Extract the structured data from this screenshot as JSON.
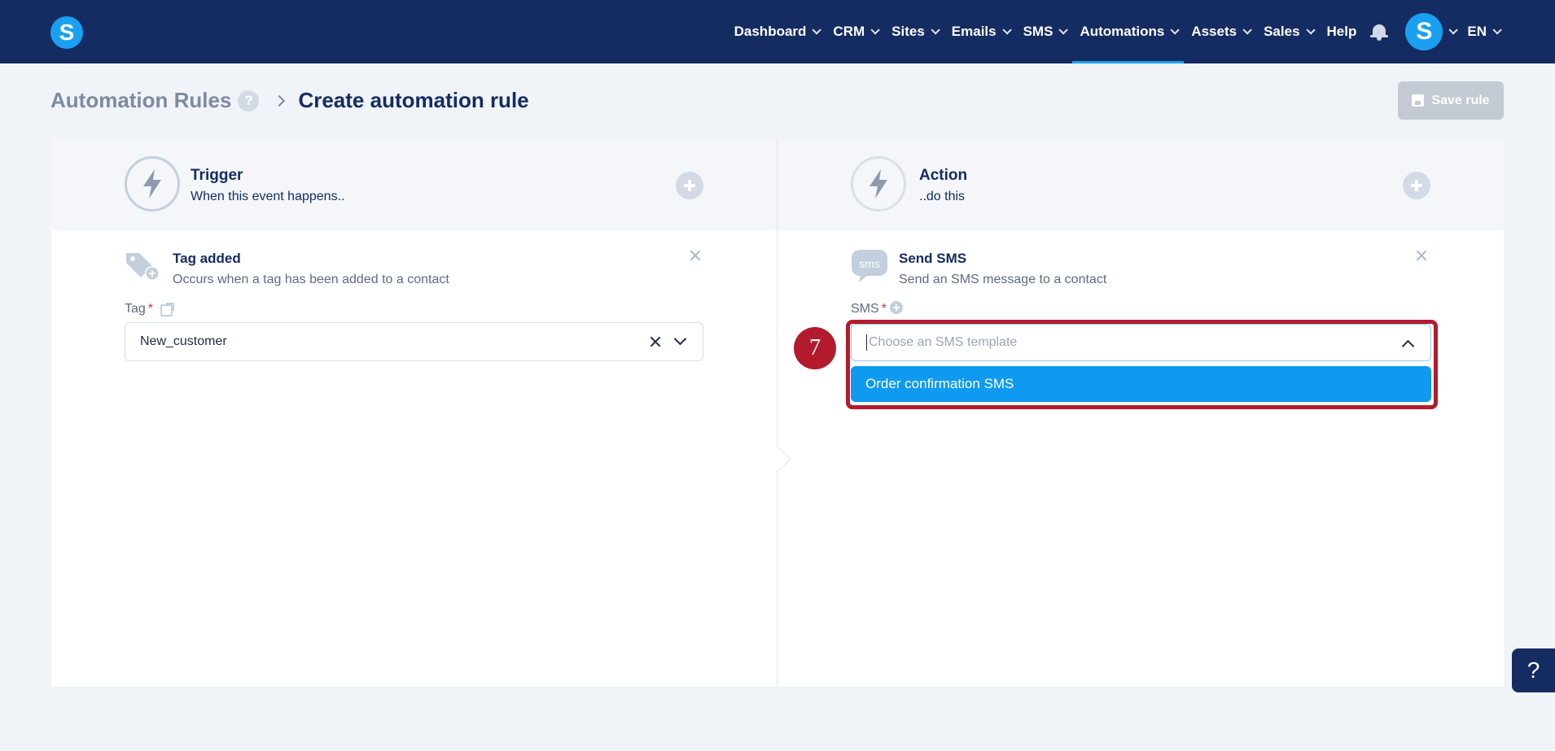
{
  "app": {
    "logo_letter": "S",
    "accent": "#1aa0f0",
    "nav_bg": "#152c62"
  },
  "nav": {
    "items": [
      {
        "label": "Dashboard",
        "dropdown": true
      },
      {
        "label": "CRM",
        "dropdown": true
      },
      {
        "label": "Sites",
        "dropdown": true
      },
      {
        "label": "Emails",
        "dropdown": true
      },
      {
        "label": "SMS",
        "dropdown": true
      },
      {
        "label": "Automations",
        "dropdown": true,
        "active": true
      },
      {
        "label": "Assets",
        "dropdown": true
      },
      {
        "label": "Sales",
        "dropdown": true
      },
      {
        "label": "Help",
        "dropdown": false
      }
    ],
    "avatar_letter": "S",
    "language": "EN"
  },
  "header": {
    "breadcrumb_parent": "Automation Rules",
    "help_mark": "?",
    "title": "Create automation rule",
    "save_label": "Save rule",
    "save_disabled": true
  },
  "trigger": {
    "title": "Trigger",
    "subtitle": "When this event happens..",
    "block": {
      "title": "Tag added",
      "description": "Occurs when a tag has been added to a contact",
      "field_label": "Tag",
      "required_mark": "*",
      "value": "New_customer"
    }
  },
  "action": {
    "title": "Action",
    "subtitle": "..do this",
    "block": {
      "icon_text": "sms",
      "title": "Send SMS",
      "description": "Send an SMS message to a contact",
      "field_label": "SMS",
      "required_mark": "*",
      "placeholder": "Choose an SMS template",
      "options": [
        "Order confirmation SMS"
      ]
    }
  },
  "annotation": {
    "step_number": "7",
    "color": "#b31b2c"
  },
  "help_tab": {
    "label": "?"
  }
}
